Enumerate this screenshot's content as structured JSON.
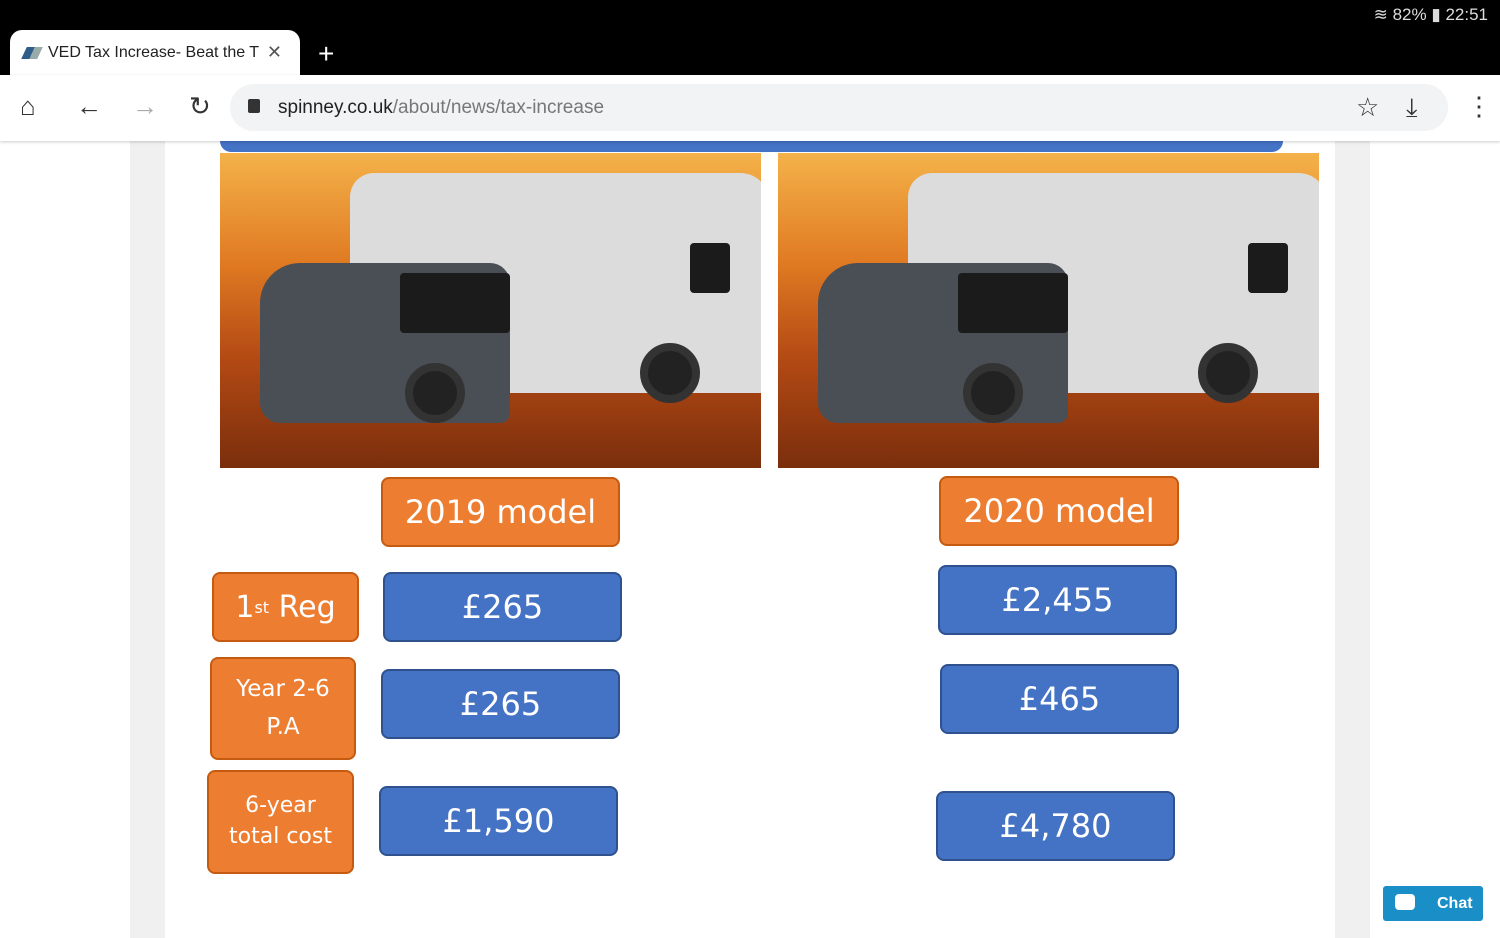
{
  "status": {
    "battery": "82%",
    "time": "22:51"
  },
  "tab": {
    "title": "VED Tax Increase- Beat the T"
  },
  "url": {
    "host": "spinney.co.uk",
    "path": "/about/news/tax-increase"
  },
  "models": [
    {
      "label": "2019 model",
      "first_reg": "£265",
      "years_2_6": "£265",
      "total": "£1,590"
    },
    {
      "label": "2020 model",
      "first_reg": "£2,455",
      "years_2_6": "£465",
      "total": "£4,780"
    }
  ],
  "rows": {
    "first_reg": "1",
    "first_reg_sup": "st",
    "first_reg_rest": " Reg",
    "years_line1": "Year 2-6",
    "years_line2": "P.A",
    "total_line1": "6-year",
    "total_line2": "total cost"
  },
  "chat": {
    "label": "Chat"
  },
  "colors": {
    "orange": "#ed7d31",
    "blue": "#4472c4",
    "chat": "#1a8fc7"
  }
}
